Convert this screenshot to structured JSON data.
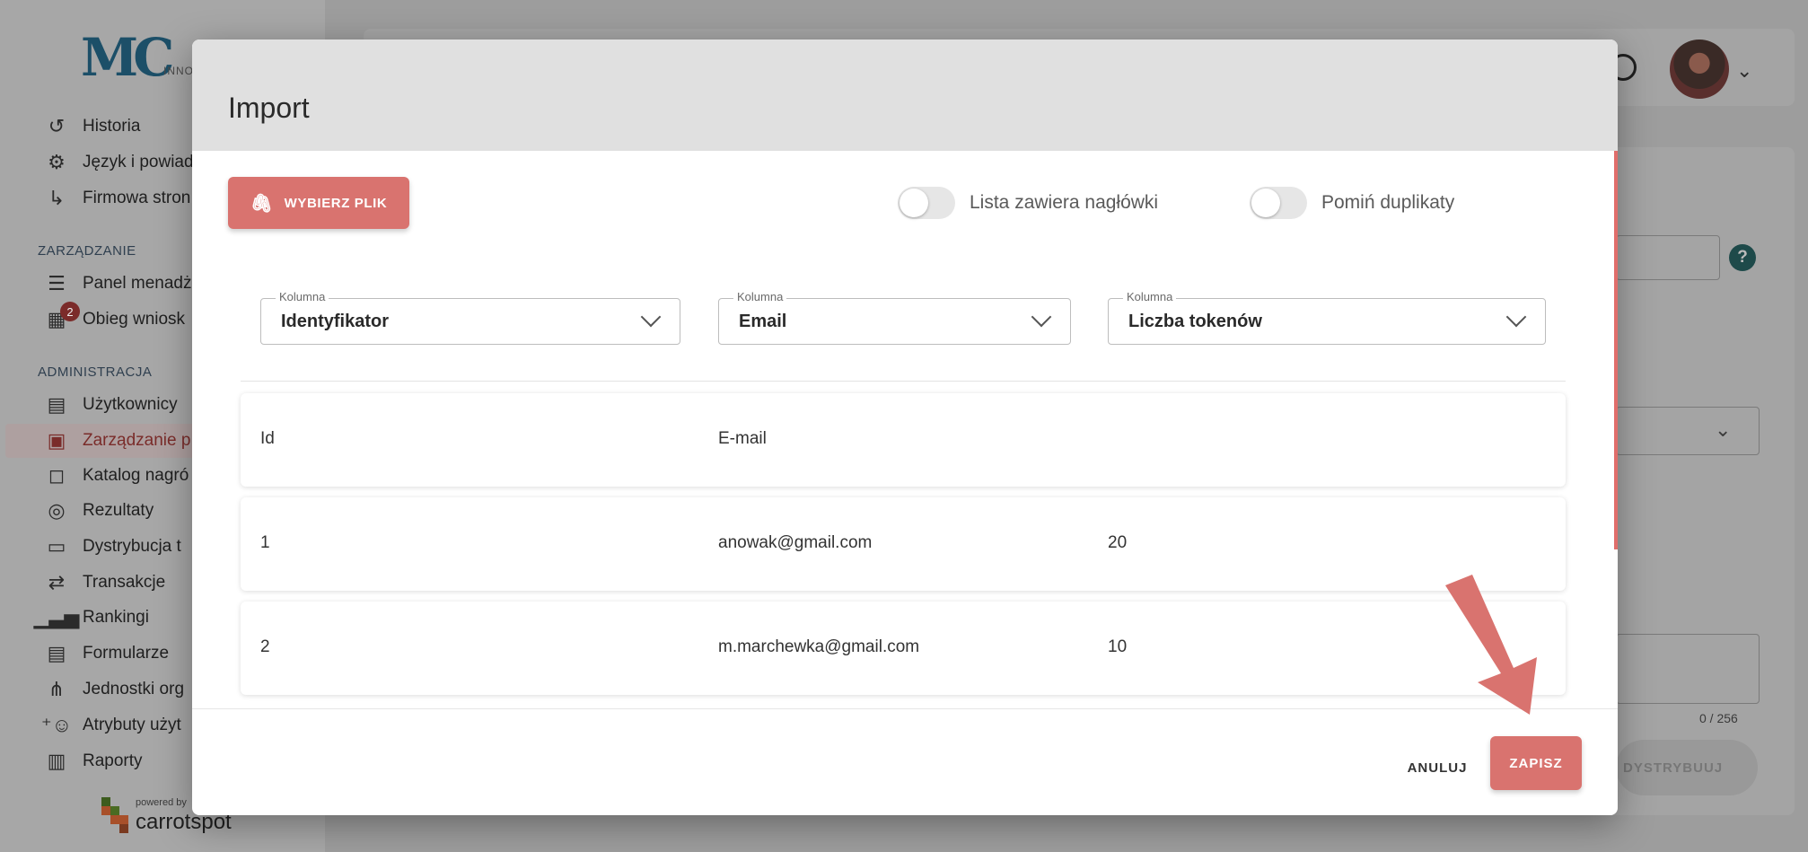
{
  "background": {
    "logo": {
      "mark": "MC",
      "sub": "INNOV"
    },
    "nav_items_top": [
      {
        "label": "Historia",
        "icon": "history-icon"
      },
      {
        "label": "Język i powiad",
        "icon": "gear-icon"
      },
      {
        "label": "Firmowa stron",
        "icon": "return-arrow-icon"
      }
    ],
    "section_manage": "ZARZĄDZANIE",
    "nav_items_manage": [
      {
        "label": "Panel menadż",
        "icon": "manager-panel-icon"
      },
      {
        "label": "Obieg wniosk",
        "icon": "workflow-icon",
        "badge": "2"
      }
    ],
    "section_admin": "ADMINISTRACJA",
    "nav_items_admin": [
      {
        "label": "Użytkownicy",
        "icon": "users-card-icon"
      },
      {
        "label": "Zarządzanie p",
        "icon": "folder-star-icon",
        "active": true
      },
      {
        "label": "Katalog nagró",
        "icon": "bag-icon"
      },
      {
        "label": "Rezultaty",
        "icon": "target-icon"
      },
      {
        "label": "Dystrybucja t",
        "icon": "ticket-icon"
      },
      {
        "label": "Transakcje",
        "icon": "swap-icon"
      },
      {
        "label": "Rankingi",
        "icon": "bar-chart-icon"
      },
      {
        "label": "Formularze",
        "icon": "form-icon"
      },
      {
        "label": "Jednostki org",
        "icon": "org-tree-icon"
      },
      {
        "label": "Atrybuty użyt",
        "icon": "user-plus-icon"
      },
      {
        "label": "Raporty",
        "icon": "clipboard-icon"
      }
    ],
    "powered_small": "powered by",
    "powered_big": "carrotspot",
    "counter": "0 / 256",
    "distribute_label": "DYSTRYBUUJ"
  },
  "modal": {
    "title": "Import",
    "choose_file_label": "WYBIERZ PLIK",
    "toggle_headers_label": "Lista zawiera nagłówki",
    "toggle_duplicates_label": "Pomiń duplikaty",
    "columns": [
      {
        "legend": "Kolumna",
        "value": "Identyfikator"
      },
      {
        "legend": "Kolumna",
        "value": "Email"
      },
      {
        "legend": "Kolumna",
        "value": "Liczba tokenów"
      }
    ],
    "rows": [
      [
        "Id",
        "E-mail",
        ""
      ],
      [
        "1",
        "anowak@gmail.com",
        "20"
      ],
      [
        "2",
        "m.marchewka@gmail.com",
        "10"
      ]
    ],
    "cancel_label": "ANULUJ",
    "save_label": "ZAPISZ"
  },
  "colors": {
    "accent": "#d9736f",
    "overlay": "#9d9d9d",
    "modal_header": "#e0e0e0"
  }
}
